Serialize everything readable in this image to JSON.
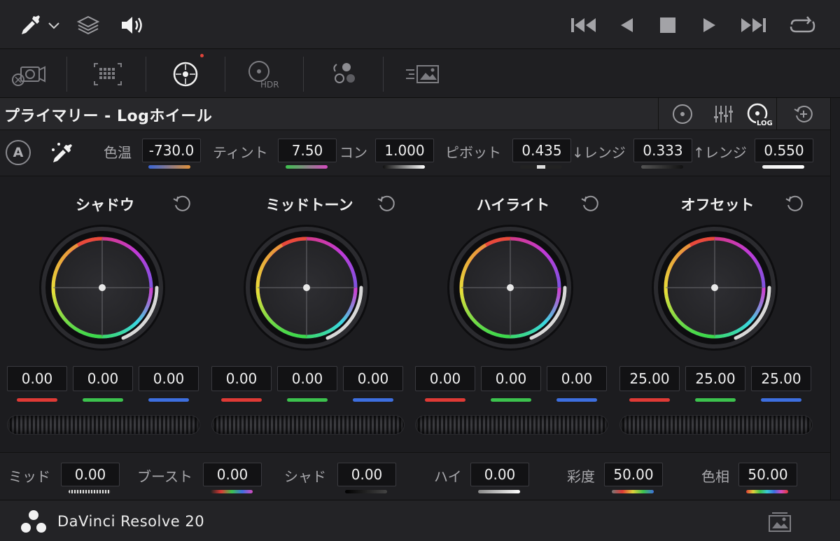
{
  "panel": {
    "title": "プライマリー - Logホイール"
  },
  "params_top": [
    {
      "label": "色温",
      "value": "-730.0"
    },
    {
      "label": "ティント",
      "value": "7.50"
    },
    {
      "label": "コン",
      "value": "1.000"
    },
    {
      "label": "ピボット",
      "value": "0.435"
    },
    {
      "label": "↓レンジ",
      "value": "0.333"
    },
    {
      "label": "↑レンジ",
      "value": "0.550"
    }
  ],
  "auto_balance_label": "A",
  "wheels": [
    {
      "title": "シャドウ",
      "r": "0.00",
      "g": "0.00",
      "b": "0.00"
    },
    {
      "title": "ミッドトーン",
      "r": "0.00",
      "g": "0.00",
      "b": "0.00"
    },
    {
      "title": "ハイライト",
      "r": "0.00",
      "g": "0.00",
      "b": "0.00"
    },
    {
      "title": "オフセット",
      "r": "25.00",
      "g": "25.00",
      "b": "25.00"
    }
  ],
  "params_bottom": [
    {
      "label": "ミッド",
      "value": "0.00"
    },
    {
      "label": "ブースト",
      "value": "0.00"
    },
    {
      "label": "シャド",
      "value": "0.00"
    },
    {
      "label": "ハイ",
      "value": "0.00"
    },
    {
      "label": "彩度",
      "value": "50.00"
    },
    {
      "label": "色相",
      "value": "50.00"
    }
  ],
  "header_icons": {
    "log_label": "LOG"
  },
  "tool_icons": {
    "hdr_label": "HDR"
  },
  "footer": {
    "app_name": "DaVinci Resolve 20"
  },
  "icons": [
    "eyedropper-icon",
    "chevron-down-icon",
    "layers-icon",
    "speaker-icon",
    "skip-back-icon",
    "play-reverse-icon",
    "stop-icon",
    "play-icon",
    "skip-forward-icon",
    "loop-icon",
    "camera-raw-icon",
    "color-match-icon",
    "primaries-wheel-icon",
    "hdr-wheel-icon",
    "rgb-mixer-icon",
    "motion-effects-icon",
    "wheel-mode-icon",
    "bars-mode-icon",
    "log-mode-icon",
    "reset-all-icon",
    "gallery-icon"
  ],
  "colors": {
    "accent_red": "#e0443a",
    "red": "#e03a35",
    "green": "#3cc34e",
    "blue": "#3d6fe0"
  }
}
